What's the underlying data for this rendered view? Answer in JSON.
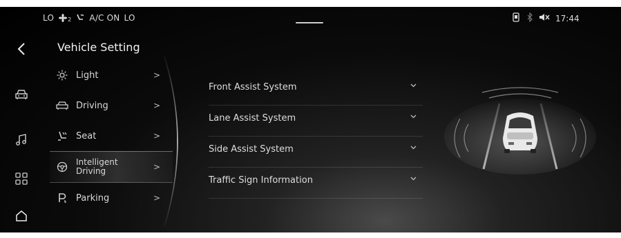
{
  "status_bar": {
    "left_temp": "LO",
    "fan_level": "2",
    "ac_label": "A/C ON",
    "right_temp": "LO",
    "time": "17:44"
  },
  "page": {
    "title": "Vehicle Setting"
  },
  "menu": [
    {
      "label": "Light",
      "icon": "sun-icon",
      "chevron": ">"
    },
    {
      "label": "Driving",
      "icon": "car-front-icon",
      "chevron": ">"
    },
    {
      "label": "Seat",
      "icon": "seat-icon",
      "chevron": ">"
    },
    {
      "label": "Intelligent Driving",
      "icon": "steering-wheel-icon",
      "chevron": ">",
      "selected": true
    },
    {
      "label": "Parking",
      "icon": "parking-icon",
      "chevron": ">"
    }
  ],
  "sections": [
    {
      "label": "Front Assist System"
    },
    {
      "label": "Lane Assist System"
    },
    {
      "label": "Side Assist System"
    },
    {
      "label": "Traffic Sign Information"
    }
  ],
  "rail_icons": [
    "back-arrow-icon",
    "car-icon",
    "music-icon",
    "apps-grid-icon",
    "home-icon"
  ],
  "colors": {
    "background": "#000000",
    "text": "#e6e6e6"
  }
}
